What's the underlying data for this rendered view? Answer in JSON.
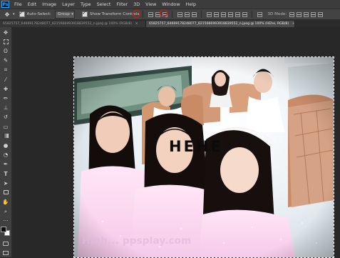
{
  "app": {
    "logo": "Ps"
  },
  "menu": [
    "File",
    "Edit",
    "Image",
    "Layer",
    "Type",
    "Select",
    "Filter",
    "3D",
    "View",
    "Window",
    "Help"
  ],
  "options": {
    "tool_icon": "move-tool-icon",
    "auto_select_label": "Auto-Select:",
    "auto_select_value": "Group",
    "show_transform_label": "Show Transform Controls",
    "mode_3d_label": "3D Mode:"
  },
  "tabs": [
    {
      "label": "65825757_64669178248077_8215666993918839552_n.jpeg @ 100% (RGB/8)",
      "close": "×",
      "active": false
    },
    {
      "label": "65825757_64669178248077_8215666993918839552_n.jpeg @ 100% (HEhe, RGB/8)",
      "close": "×",
      "active": true
    }
  ],
  "canvas": {
    "overlay_text": "HEHE",
    "watermark": "Hinh... ppsplay.com"
  },
  "colors": {
    "foreground": "#0d0d0d",
    "background": "#ffffff",
    "annotation": "#d31c1c"
  }
}
